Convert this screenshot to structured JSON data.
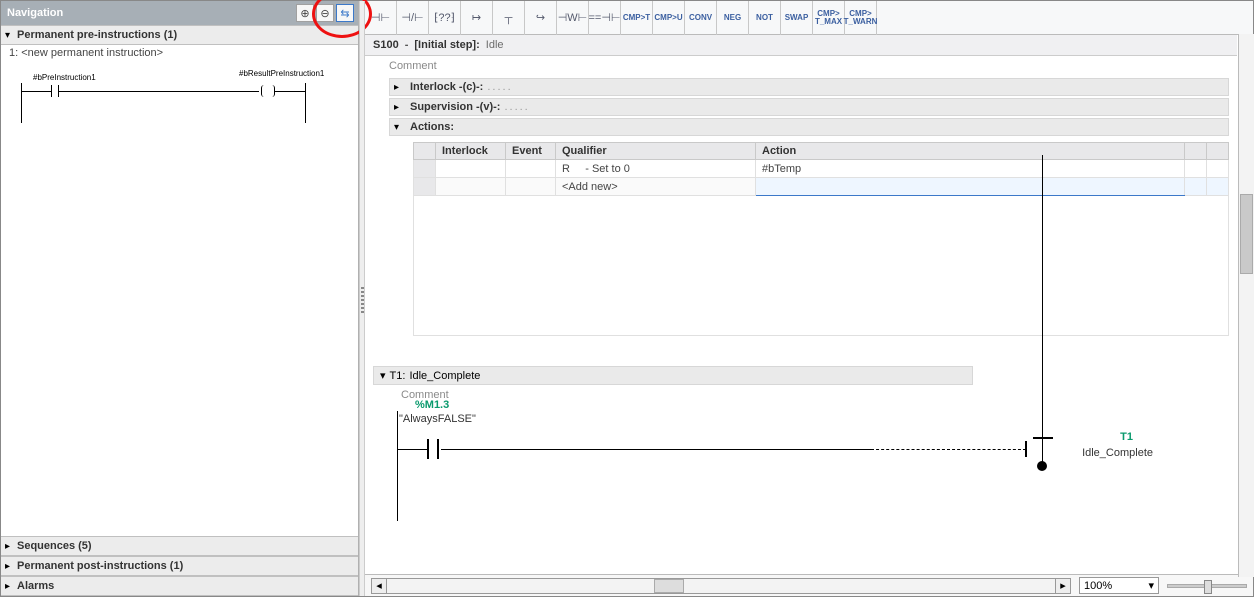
{
  "nav": {
    "title": "Navigation",
    "sections": {
      "pre": "Permanent pre-instructions (1)",
      "seq": "Sequences (5)",
      "post": "Permanent post-instructions (1)",
      "alarms": "Alarms"
    },
    "perm_line": "1: <new permanent instruction>",
    "mini_labels": {
      "left": "#bPreInstruction1",
      "right": "#bResultPreInstruction1"
    }
  },
  "toolbar": [
    "⊣⊢",
    "⊣/⊢",
    "⁅??⁆",
    "↦",
    "┬",
    "↪",
    "⊣W⊢",
    "==⊣⊢",
    "CMP>T",
    "CMP>U",
    "CONV",
    "NEG",
    "NOT",
    "SWAP",
    "CMP> T_MAX",
    "CMP> T_WARN"
  ],
  "step": {
    "id": "S100",
    "label": "[Initial step]:",
    "name": "Idle",
    "comment": "Comment",
    "interlock": "Interlock -(c)-:",
    "supervision": "Supervision -(v)-:",
    "actions": "Actions:",
    "dots": "....."
  },
  "actions_table": {
    "headers": {
      "interlock": "Interlock",
      "event": "Event",
      "qualifier": "Qualifier",
      "action": "Action"
    },
    "row1": {
      "qualifier_code": "R",
      "qualifier_desc": "- Set to 0",
      "action": "#bTemp"
    },
    "addnew": "<Add new>"
  },
  "transition": {
    "id": "T1:",
    "name": "Idle_Complete",
    "comment": "Comment",
    "tag_addr": "%M1.3",
    "tag_name": "\"AlwaysFALSE\"",
    "end_id": "T1",
    "end_name": "Idle_Complete"
  },
  "zoom": "100%"
}
